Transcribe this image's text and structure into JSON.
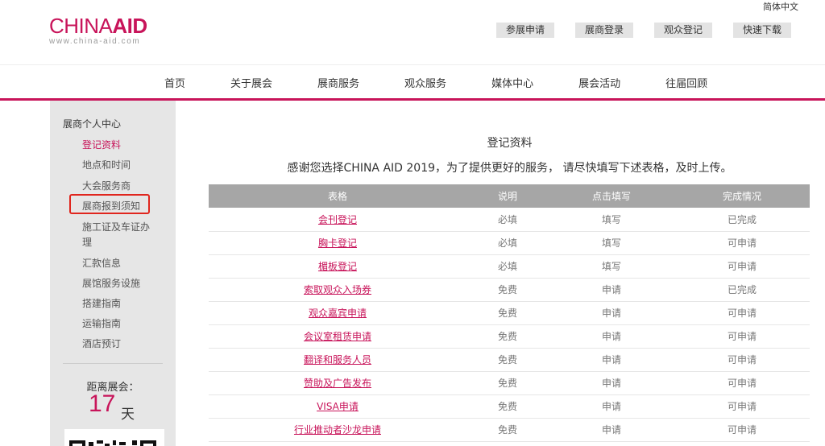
{
  "header": {
    "language": "简体中文",
    "logo_left": "CHINA",
    "logo_right": "AID",
    "logo_url": "www.china-aid.com",
    "top_buttons": [
      "参展申请",
      "展商登录",
      "观众登记",
      "快速下载"
    ]
  },
  "nav": {
    "items": [
      "首页",
      "关于展会",
      "展商服务",
      "观众服务",
      "媒体中心",
      "展会活动",
      "往届回顾"
    ]
  },
  "sidebar": {
    "title": "展商个人中心",
    "items": [
      {
        "label": "登记资料",
        "active": true
      },
      {
        "label": "地点和时间",
        "active": false
      },
      {
        "label": "大会服务商",
        "active": false
      },
      {
        "label": "展商报到须知",
        "active": false
      },
      {
        "label": "施工证及车证办",
        "active": false
      },
      {
        "label": "理",
        "active": false
      },
      {
        "label": "汇款信息",
        "active": false
      },
      {
        "label": "展馆服务设施",
        "active": false
      },
      {
        "label": "搭建指南",
        "active": false
      },
      {
        "label": "运输指南",
        "active": false
      },
      {
        "label": "酒店预订",
        "active": false
      }
    ],
    "countdown_label": "距离展会：",
    "countdown_value": "17",
    "countdown_unit": "天"
  },
  "main": {
    "title": "登记资料",
    "subtitle": "感谢您选择CHINA AID 2019，为了提供更好的服务， 请尽快填写下述表格，及时上传。",
    "table": {
      "headers": [
        "表格",
        "说明",
        "点击填写",
        "完成情况"
      ],
      "rows": [
        [
          "会刊登记",
          "必填",
          "填写",
          "已完成"
        ],
        [
          "胸卡登记",
          "必填",
          "填写",
          "可申请"
        ],
        [
          "楣板登记",
          "必填",
          "填写",
          "可申请"
        ],
        [
          "索取观众入场券",
          "免费",
          "申请",
          "已完成"
        ],
        [
          "观众嘉宾申请",
          "免费",
          "申请",
          "可申请"
        ],
        [
          "会议室租赁申请",
          "免费",
          "申请",
          "可申请"
        ],
        [
          "翻译和服务人员",
          "免费",
          "申请",
          "可申请"
        ],
        [
          "赞助及广告发布",
          "免费",
          "申请",
          "可申请"
        ],
        [
          "VISA申请",
          "免费",
          "申请",
          "可申请"
        ],
        [
          "行业推动者沙龙申请",
          "免费",
          "申请",
          "可申请"
        ]
      ]
    }
  },
  "colors": {
    "brand": "#c8145a",
    "highlight_box": "#e0261e",
    "table_header": "#a6a6a6"
  }
}
